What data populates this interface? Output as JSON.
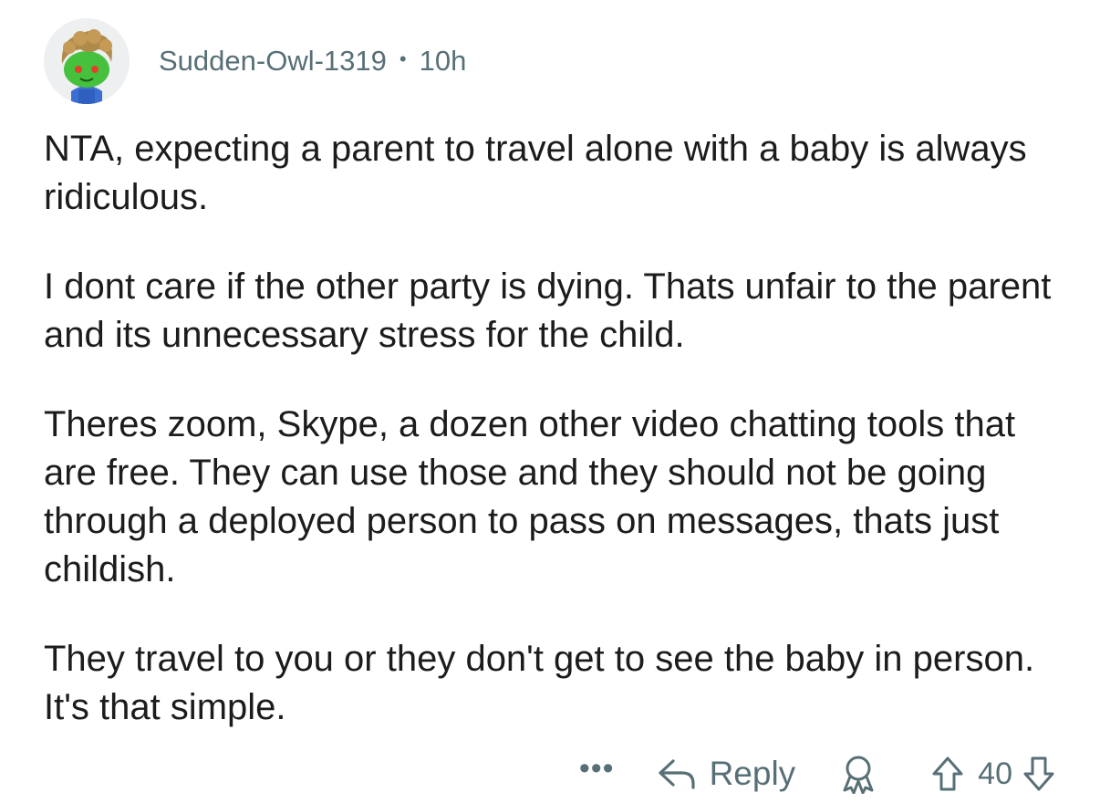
{
  "comment": {
    "author": "Sudden-Owl-1319",
    "separator": "•",
    "age": "10h",
    "paragraphs": [
      "NTA, expecting a parent to travel alone with a baby is always ridiculous.",
      "I dont care if the other party is dying. Thats unfair to the parent and its unnecessary stress for the child.",
      "Theres zoom, Skype, a dozen other video chatting tools that are free. They can use those and they should not be going through a deployed person to pass on messages, thats just childish.",
      "They travel to you or they don't get to see the baby in person. It's that simple."
    ]
  },
  "actions": {
    "more_label": "•••",
    "reply_label": "Reply",
    "score": "40"
  },
  "icons": {
    "avatar": "snoo-avatar-icon",
    "reply": "reply-arrow-icon",
    "award": "award-icon",
    "upvote": "upvote-arrow-icon",
    "downvote": "downvote-arrow-icon"
  },
  "colors": {
    "meta_text": "#576f76",
    "body_text": "#1c1c1c",
    "avatar_bg": "#edeff1"
  }
}
